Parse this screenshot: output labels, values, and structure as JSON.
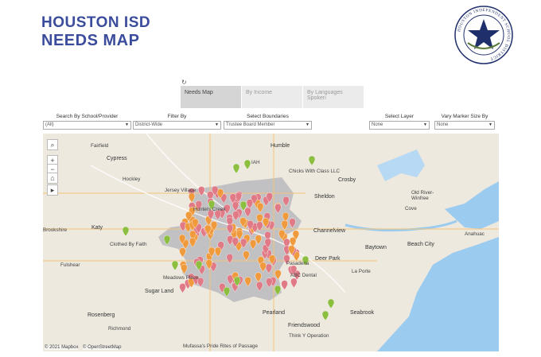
{
  "header": {
    "line1": "HOUSTON ISD",
    "line2": "NEEDS MAP"
  },
  "logo": {
    "text": "HOUSTON INDEPENDENT SCHOOL DISTRICT",
    "color": "#1f2f6b"
  },
  "refresh_icon": "↻",
  "tabs": [
    {
      "label": "Needs Map",
      "active": true
    },
    {
      "label": "By Income",
      "active": false
    },
    {
      "label": "By Languages Spoken",
      "active": false
    }
  ],
  "filters": {
    "school": {
      "label": "Search By School/Provider",
      "value": "(All)"
    },
    "filter_by": {
      "label": "Filter By",
      "value": "District-Wide"
    },
    "boundaries": {
      "label": "Select Boundaries",
      "value": "Trustee Board Member"
    },
    "layer": {
      "label": "Select Layer",
      "value": "None"
    },
    "marker_size": {
      "label": "Vary Marker Size By",
      "value": "None"
    }
  },
  "map": {
    "controls": {
      "search": "⌕",
      "zoom_in": "+",
      "zoom_out": "−",
      "home": "⌂",
      "expand": "▸"
    },
    "attribution_mapbox": "© 2021 Mapbox",
    "attribution_osm": "© OpenStreetMap",
    "places": [
      "Fairfield",
      "Humble",
      "Cypress",
      "IAH",
      "Chicks With Class LLC",
      "Crosby",
      "Jersey Village",
      "Sheldon",
      "Old River-Winfree",
      "Katy",
      "Brookshire",
      "Clothed By Faith",
      "Hunters Creek",
      "Channelview",
      "Mont Belvieu",
      "Cove",
      "Anahuac",
      "Fulshear",
      "Baytown",
      "Beach City",
      "Deer Park",
      "La Porte",
      "Meadows Place",
      "Sugar Land",
      "ABC Dental",
      "Pasadena",
      "Seabrook",
      "Rosenberg",
      "Pearland",
      "Friendswood",
      "Richmond",
      "Think Y Operation",
      "Mufassa's Pride Rites of Passage",
      "Hockley"
    ],
    "colors": {
      "land": "#ede9df",
      "water": "#9ccbf0",
      "boundary": "#b5b5bc",
      "marker_red": "#e07a86",
      "marker_orange": "#f09a3e",
      "marker_green": "#8cbf3f"
    }
  }
}
